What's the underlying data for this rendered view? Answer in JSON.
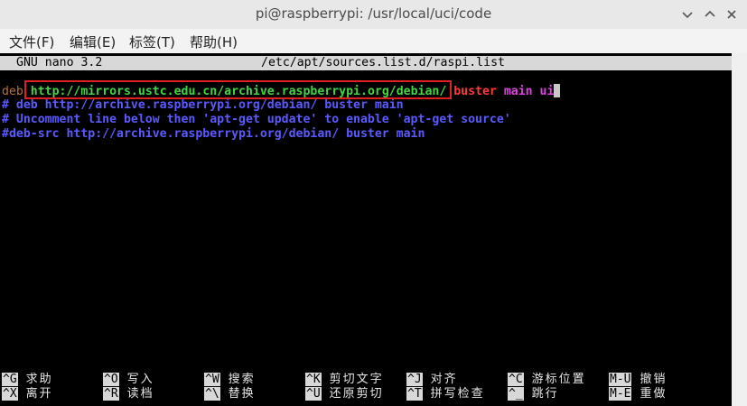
{
  "window": {
    "title": "pi@raspberrypi: /usr/local/uci/code",
    "minimize_icon": "minimize-icon",
    "maximize_icon": "maximize-icon",
    "close_icon": "close-icon"
  },
  "menu": [
    {
      "label": "文件(F)"
    },
    {
      "label": "编辑(E)"
    },
    {
      "label": "标签(T)"
    },
    {
      "label": "帮助(H)"
    }
  ],
  "nano": {
    "version": "GNU nano 3.2",
    "filename": "/etc/apt/sources.list.d/raspi.list"
  },
  "editor": {
    "line1": {
      "kw": "deb",
      "url": "http://mirrors.ustc.edu.cn/archive.raspberrypi.org/debian/",
      "dist": "buster",
      "comp1": "main",
      "comp2": "ui"
    },
    "line2": "# deb http://archive.raspberrypi.org/debian/ buster main",
    "line3": "# Uncomment line below then 'apt-get update' to enable 'apt-get source'",
    "line4": "#deb-src http://archive.raspberrypi.org/debian/ buster main"
  },
  "shortcuts": [
    {
      "key": "^G",
      "label": "求助"
    },
    {
      "key": "^O",
      "label": "写入"
    },
    {
      "key": "^W",
      "label": "搜索"
    },
    {
      "key": "^K",
      "label": "剪切文字"
    },
    {
      "key": "^J",
      "label": "对齐"
    },
    {
      "key": "^C",
      "label": "游标位置"
    },
    {
      "key": "M-U",
      "label": "撤销"
    },
    {
      "key": "^X",
      "label": "离开"
    },
    {
      "key": "^R",
      "label": "读档"
    },
    {
      "key": "^\\",
      "label": "替换"
    },
    {
      "key": "^U",
      "label": "还原剪切"
    },
    {
      "key": "^T",
      "label": "拼写检查"
    },
    {
      "key": "^_",
      "label": "跳行"
    },
    {
      "key": "M-E",
      "label": "重做"
    }
  ],
  "colors": {
    "terminal_bg": "#000000",
    "url_green": "#44d444",
    "keyword_red": "#ff3b3b",
    "component_magenta": "#e040e0",
    "comment_blue": "#5a5aff",
    "highlight_box": "#e02020"
  }
}
